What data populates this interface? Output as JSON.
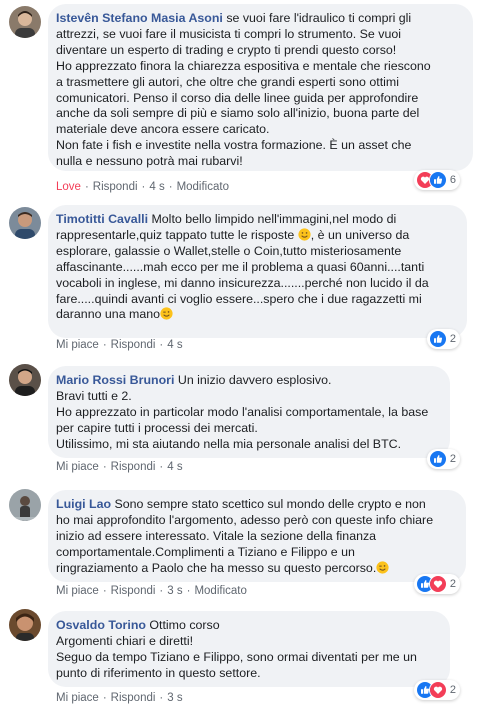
{
  "colors": {
    "author_link": "#385898",
    "bubble_bg": "#f0f2f5",
    "love_red": "#f33e58",
    "like_blue": "#1877f2",
    "meta_grey": "#606770"
  },
  "comments": [
    {
      "author": "Istevên Stefano Masia Asoni",
      "lines": [
        " se vuoi fare l'idraulico ti compri gli",
        "attrezzi, se vuoi fare il musicista ti compri lo strumento. Se vuoi",
        "diventare un esperto di trading e crypto ti prendi questo corso!",
        "Ho apprezzato finora la chiarezza espositiva e mentale che riescono",
        "a trasmettere gli autori, che oltre che grandi esperti sono ottimi",
        "comunicatori. Penso il corso dia delle linee guida per approfondire",
        "anche da soli sempre di più e siamo solo all'inizio, buona parte del",
        "materiale deve ancora essere caricato.",
        "Non fate i fish e investite nella vostra formazione. È un asset che",
        "nulla e nessuno potrà mai rubarvi!"
      ],
      "like_label": "Love",
      "reply_label": "Rispondi",
      "time": "4 s",
      "edited": "Modificato",
      "reaction_icons": [
        "heart-icon",
        "like-icon"
      ],
      "reaction_count": "6"
    },
    {
      "author": "Timotitti Cavalli",
      "lines": [
        " Molto bello limpido nell'immagini,nel modo di",
        "rappresentarle,quiz tappato tutte le risposte ",
        ", è un universo da",
        "esplorare, galassie o Wallet,stelle o Coin,tutto misteriosamente",
        "affascinante......mah ecco per me il problema a quasi 60anni....tanti",
        "vocaboli in inglese, mi danno insicurezza.......perché non lucido il da",
        "fare.....quindi avanti ci voglio essere...spero che i due ragazzetti mi",
        "daranno una mano"
      ],
      "like_label": "Mi piace",
      "reply_label": "Rispondi",
      "time": "4 s",
      "reaction_icons": [
        "like-icon"
      ],
      "reaction_count": "2"
    },
    {
      "author": "Mario Rossi Brunori",
      "lines": [
        " Un inizio davvero esplosivo.",
        "Bravi tutti e 2.",
        "Ho apprezzato in particolar modo l'analisi comportamentale, la base",
        "per capire tutti i processi dei mercati.",
        "Utilissimo, mi sta aiutando nella mia personale analisi del BTC."
      ],
      "like_label": "Mi piace",
      "reply_label": "Rispondi",
      "time": "4 s",
      "reaction_icons": [
        "like-icon"
      ],
      "reaction_count": "2"
    },
    {
      "author": "Luigi Lao",
      "lines": [
        " Sono sempre stato scettico sul mondo delle crypto e non",
        "ho mai approfondito l'argomento, adesso però con queste info chiare",
        "inizio ad essere interessato. Vitale la sezione della finanza",
        "comportamentale.Complimenti a Tiziano e Filippo e un",
        "ringraziamento a Paolo che ha messo su questo percorso."
      ],
      "like_label": "Mi piace",
      "reply_label": "Rispondi",
      "time": "3 s",
      "edited": "Modificato",
      "reaction_icons": [
        "like-icon",
        "heart-icon"
      ],
      "reaction_count": "2"
    },
    {
      "author": "Osvaldo Torino",
      "lines": [
        " Ottimo corso",
        "Argomenti chiari e diretti!",
        "Seguo da tempo Tiziano e Filippo, sono ormai diventati per me un",
        "punto di riferimento in questo settore."
      ],
      "like_label": "Mi piace",
      "reply_label": "Rispondi",
      "time": "3 s",
      "reaction_icons": [
        "like-icon",
        "heart-icon"
      ],
      "reaction_count": "2"
    }
  ]
}
